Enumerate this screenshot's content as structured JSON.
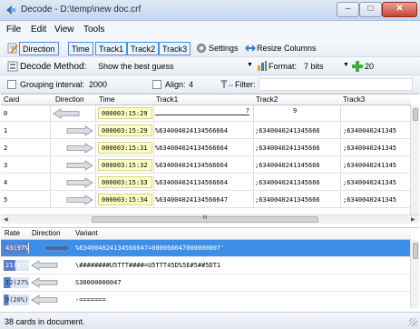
{
  "window": {
    "title": "Decode - D:\\temp\\new doc.crf",
    "min_glyph": "–",
    "max_glyph": "□",
    "close_glyph": "✕"
  },
  "menu": [
    "File",
    "Edit",
    "View",
    "Tools"
  ],
  "toolbar1": {
    "columns": [
      "Direction",
      "Time",
      "Track1",
      "Track2",
      "Track3"
    ],
    "settings_label": "Settings",
    "resize_label": "Resize Columns"
  },
  "toolbar2": {
    "decode_method_label": "Decode Method:",
    "decode_method_value": "Show the best guess",
    "format_label": "Format:",
    "format_value": "7 bits",
    "count_value": "20"
  },
  "toolbar3": {
    "grouping_label": "Grouping interval:",
    "grouping_value": "2000",
    "align_label": "Align:",
    "align_value": "4",
    "filter_label": "Filter:"
  },
  "top_grid": {
    "headers": [
      "Card",
      "Direction",
      "Time",
      "Track1",
      "Track2",
      "Track3"
    ],
    "rows": [
      {
        "card": "0",
        "dir": "left",
        "time": "000003:15:29",
        "track1": "?",
        "track2": "9",
        "track3": ""
      },
      {
        "card": "1",
        "dir": "right",
        "time": "000003:15:29",
        "track1": "%634004024134566664",
        "track2": ";6340040241345666",
        "track3": ";6340040241345"
      },
      {
        "card": "2",
        "dir": "right",
        "time": "000003:15:31",
        "track1": "%634004024134566664",
        "track2": ";6340040241345666",
        "track3": ";6340040241345"
      },
      {
        "card": "3",
        "dir": "right",
        "time": "000003:15:32",
        "track1": "%634004024134566664",
        "track2": ";6340040241345666",
        "track3": ";6340040241345"
      },
      {
        "card": "4",
        "dir": "right",
        "time": "000003:15:33",
        "track1": "%634004024134566664",
        "track2": ";6340040241345666",
        "track3": ";6340040241345"
      },
      {
        "card": "5",
        "dir": "right",
        "time": "000003:15:34",
        "track1": "%634004024134566647",
        "track2": ";6340040241345666",
        "track3": ";6340040241345"
      }
    ],
    "hscroll_center": "III"
  },
  "bottom_grid": {
    "headers": [
      "Rate",
      "Direction",
      "Variant"
    ],
    "rows": [
      {
        "rate": "43(97%",
        "dir": "right",
        "variant": "%634004024134566647=000066647000000007'",
        "selected": true,
        "fill": 0.97
      },
      {
        "rate": "21(47%",
        "dir": "left",
        "variant": "\\########U5TTT####=U5TTT45D%5E#5##5DT1",
        "selected": false,
        "fill": 0.47
      },
      {
        "rate": "12(27%",
        "dir": "left",
        "variant": "S30000000047",
        "selected": false,
        "fill": 0.27
      },
      {
        "rate": "9(20%)",
        "dir": "left",
        "variant": "-=======",
        "selected": false,
        "fill": 0.2
      }
    ]
  },
  "status": {
    "text": "38 cards in document."
  },
  "colors": {
    "accent": "#3d8ee8",
    "rate_bar": "#5a7fc4",
    "time_bg": "#ffffc4",
    "arrow_fill": "#d9dde3",
    "arrow_stroke": "#8c949e"
  }
}
